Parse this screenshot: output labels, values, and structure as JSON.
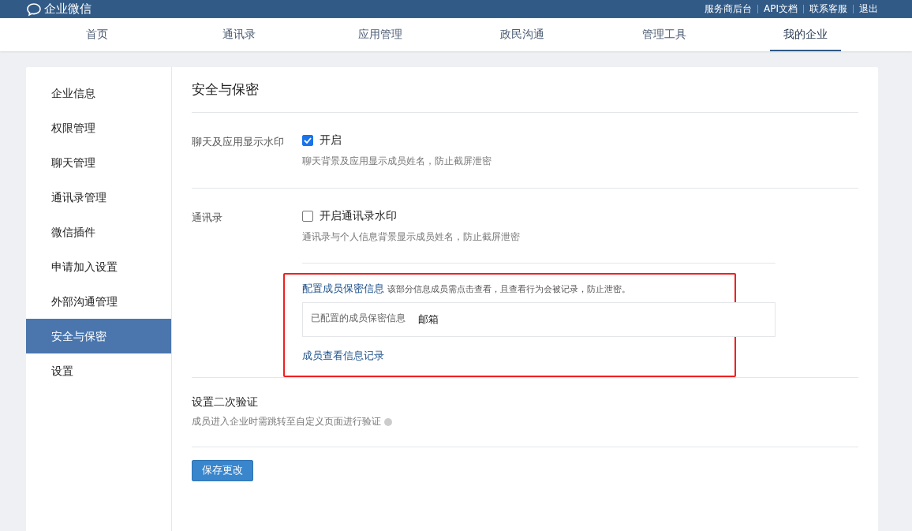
{
  "topbar": {
    "logo": "企业微信",
    "links": [
      "服务商后台",
      "API文档",
      "联系客服",
      "退出"
    ]
  },
  "nav": [
    {
      "label": "首页",
      "selected": false
    },
    {
      "label": "通讯录",
      "selected": false
    },
    {
      "label": "应用管理",
      "selected": false
    },
    {
      "label": "政民沟通",
      "selected": false
    },
    {
      "label": "管理工具",
      "selected": false
    },
    {
      "label": "我的企业",
      "selected": true
    }
  ],
  "sidebar": {
    "items": [
      {
        "label": "企业信息",
        "selected": false
      },
      {
        "label": "权限管理",
        "selected": false
      },
      {
        "label": "聊天管理",
        "selected": false
      },
      {
        "label": "通讯录管理",
        "selected": false
      },
      {
        "label": "微信插件",
        "selected": false
      },
      {
        "label": "申请加入设置",
        "selected": false
      },
      {
        "label": "外部沟通管理",
        "selected": false
      },
      {
        "label": "安全与保密",
        "selected": true
      },
      {
        "label": "设置",
        "selected": false
      }
    ]
  },
  "page_title": "安全与保密",
  "watermark_chat": {
    "label": "聊天及应用显示水印",
    "option": "开启",
    "checked": true,
    "hint": "聊天背景及应用显示成员姓名，防止截屏泄密"
  },
  "contacts": {
    "label": "通讯录",
    "option": "开启通讯录水印",
    "checked": false,
    "hint": "通讯录与个人信息背景显示成员姓名，防止截屏泄密",
    "secret": {
      "link": "配置成员保密信息",
      "note": "该部分信息成员需点击查看，且查看行为会被记录，防止泄密。",
      "configured_label": "已配置的成员保密信息",
      "configured_value": "邮箱",
      "log_link": "成员查看信息记录"
    }
  },
  "second_verify": {
    "title": "设置二次验证",
    "hint": "成员进入企业时需跳转至自定义页面进行验证"
  },
  "save_button": "保存更改"
}
